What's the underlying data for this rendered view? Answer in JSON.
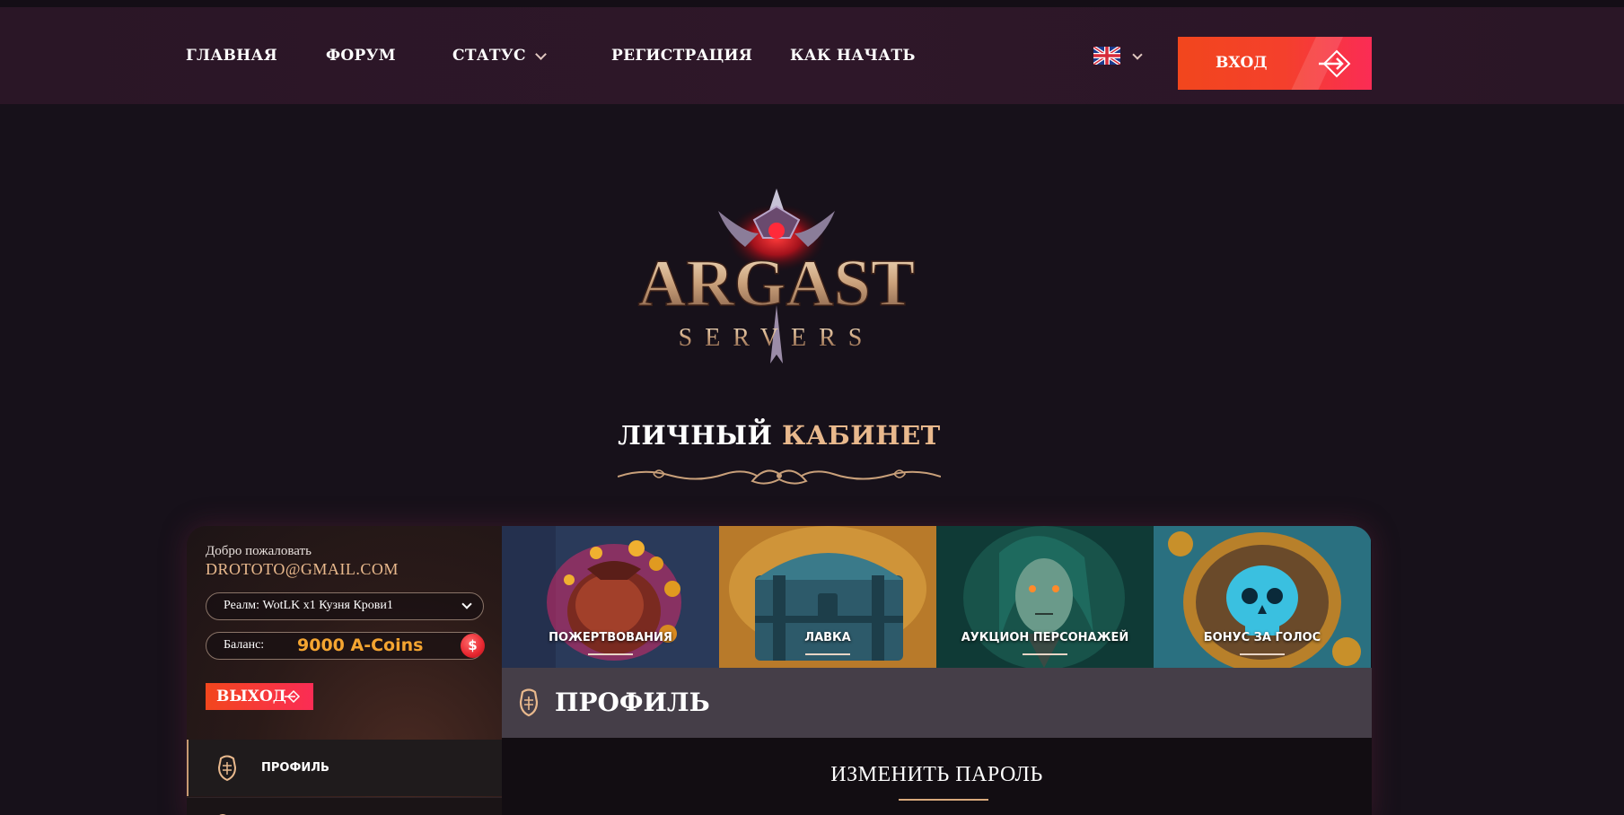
{
  "nav": {
    "items": [
      {
        "label": "ГЛАВНАЯ"
      },
      {
        "label": "ФОРУМ"
      },
      {
        "label": "СТАТУС"
      },
      {
        "label": "РЕГИСТРАЦИЯ"
      },
      {
        "label": "КАК НАЧАТЬ"
      }
    ],
    "language_icon": "uk-flag-icon",
    "login_label": "ВХОД"
  },
  "logo": {
    "main": "ARGAST",
    "sub": "SERVERS"
  },
  "page_title": {
    "part1": "ЛИЧНЫЙ",
    "part2": "КАБИНЕТ"
  },
  "sidebar": {
    "welcome": "Добро пожаловать",
    "email": "DROTOTO@GMAIL.COM",
    "realm": "Реалм: WotLK x1 Кузня Крови1",
    "balance_label": "Баланс:",
    "balance_value": "9000 A-Coins",
    "coin_symbol": "$",
    "logout_label": "ВЫХОД",
    "menu": [
      {
        "label": "ПРОФИЛЬ",
        "icon": "profile-icon"
      }
    ]
  },
  "tiles": [
    {
      "label": "ПОЖЕРТВОВАНИЯ"
    },
    {
      "label": "ЛАВКА"
    },
    {
      "label": "АУКЦИОН ПЕРСОНАЖЕЙ"
    },
    {
      "label": "БОНУС ЗА ГОЛОС"
    }
  ],
  "profile": {
    "title": "ПРОФИЛЬ",
    "section_title": "ИЗМЕНИТЬ ПАРОЛЬ"
  },
  "colors": {
    "accent": "#e9b98d",
    "button_start": "#f2461d",
    "button_end": "#fb2c55",
    "balance": "#f4a531"
  }
}
